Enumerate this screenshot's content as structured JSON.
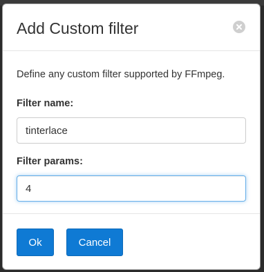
{
  "dialog": {
    "title": "Add Custom filter",
    "close_icon": "close-circle-icon",
    "description": "Define any custom filter supported by FFmpeg.",
    "fields": {
      "filter_name": {
        "label": "Filter name:",
        "value": "tinterlace"
      },
      "filter_params": {
        "label": "Filter params:",
        "value": "4"
      }
    },
    "buttons": {
      "ok": "Ok",
      "cancel": "Cancel"
    }
  },
  "colors": {
    "primary_button": "#0f7ad4",
    "focus_border": "#66afe9",
    "close_icon_bg": "#cfcfcf"
  }
}
